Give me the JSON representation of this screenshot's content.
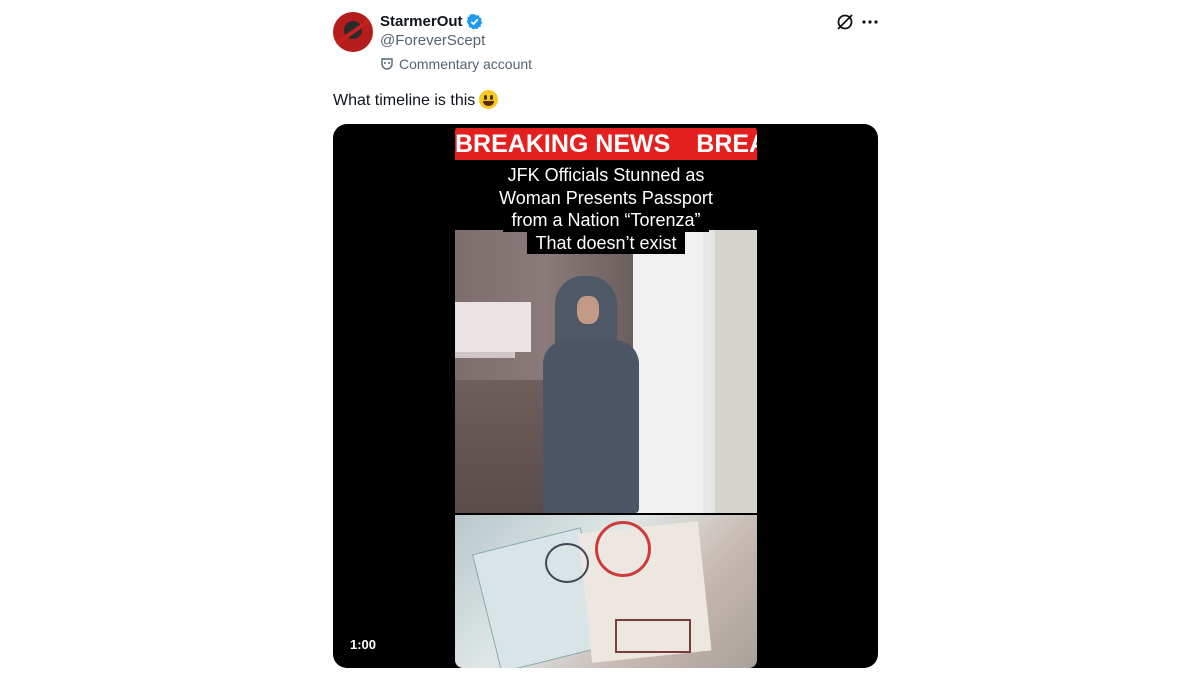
{
  "author": {
    "display_name": "StarmerOut",
    "handle": "@ForeverScept",
    "label": "Commentary account",
    "verified_icon": "verified-badge-icon",
    "verified_color": "#1d9bf0"
  },
  "tweet": {
    "text": "What timeline is this",
    "emoji": "grinning-face-emoji"
  },
  "actions": {
    "grok_icon": "grok-icon",
    "more_icon": "more-options-icon"
  },
  "media": {
    "banner_text": "BREAKING NEWS",
    "banner_text_repeat": "BREA",
    "caption_lines": [
      "JFK Officials Stunned as",
      "Woman Presents Passport",
      "from a Nation “Torenza”",
      "That doesn’t exist"
    ],
    "duration": "1:00"
  }
}
